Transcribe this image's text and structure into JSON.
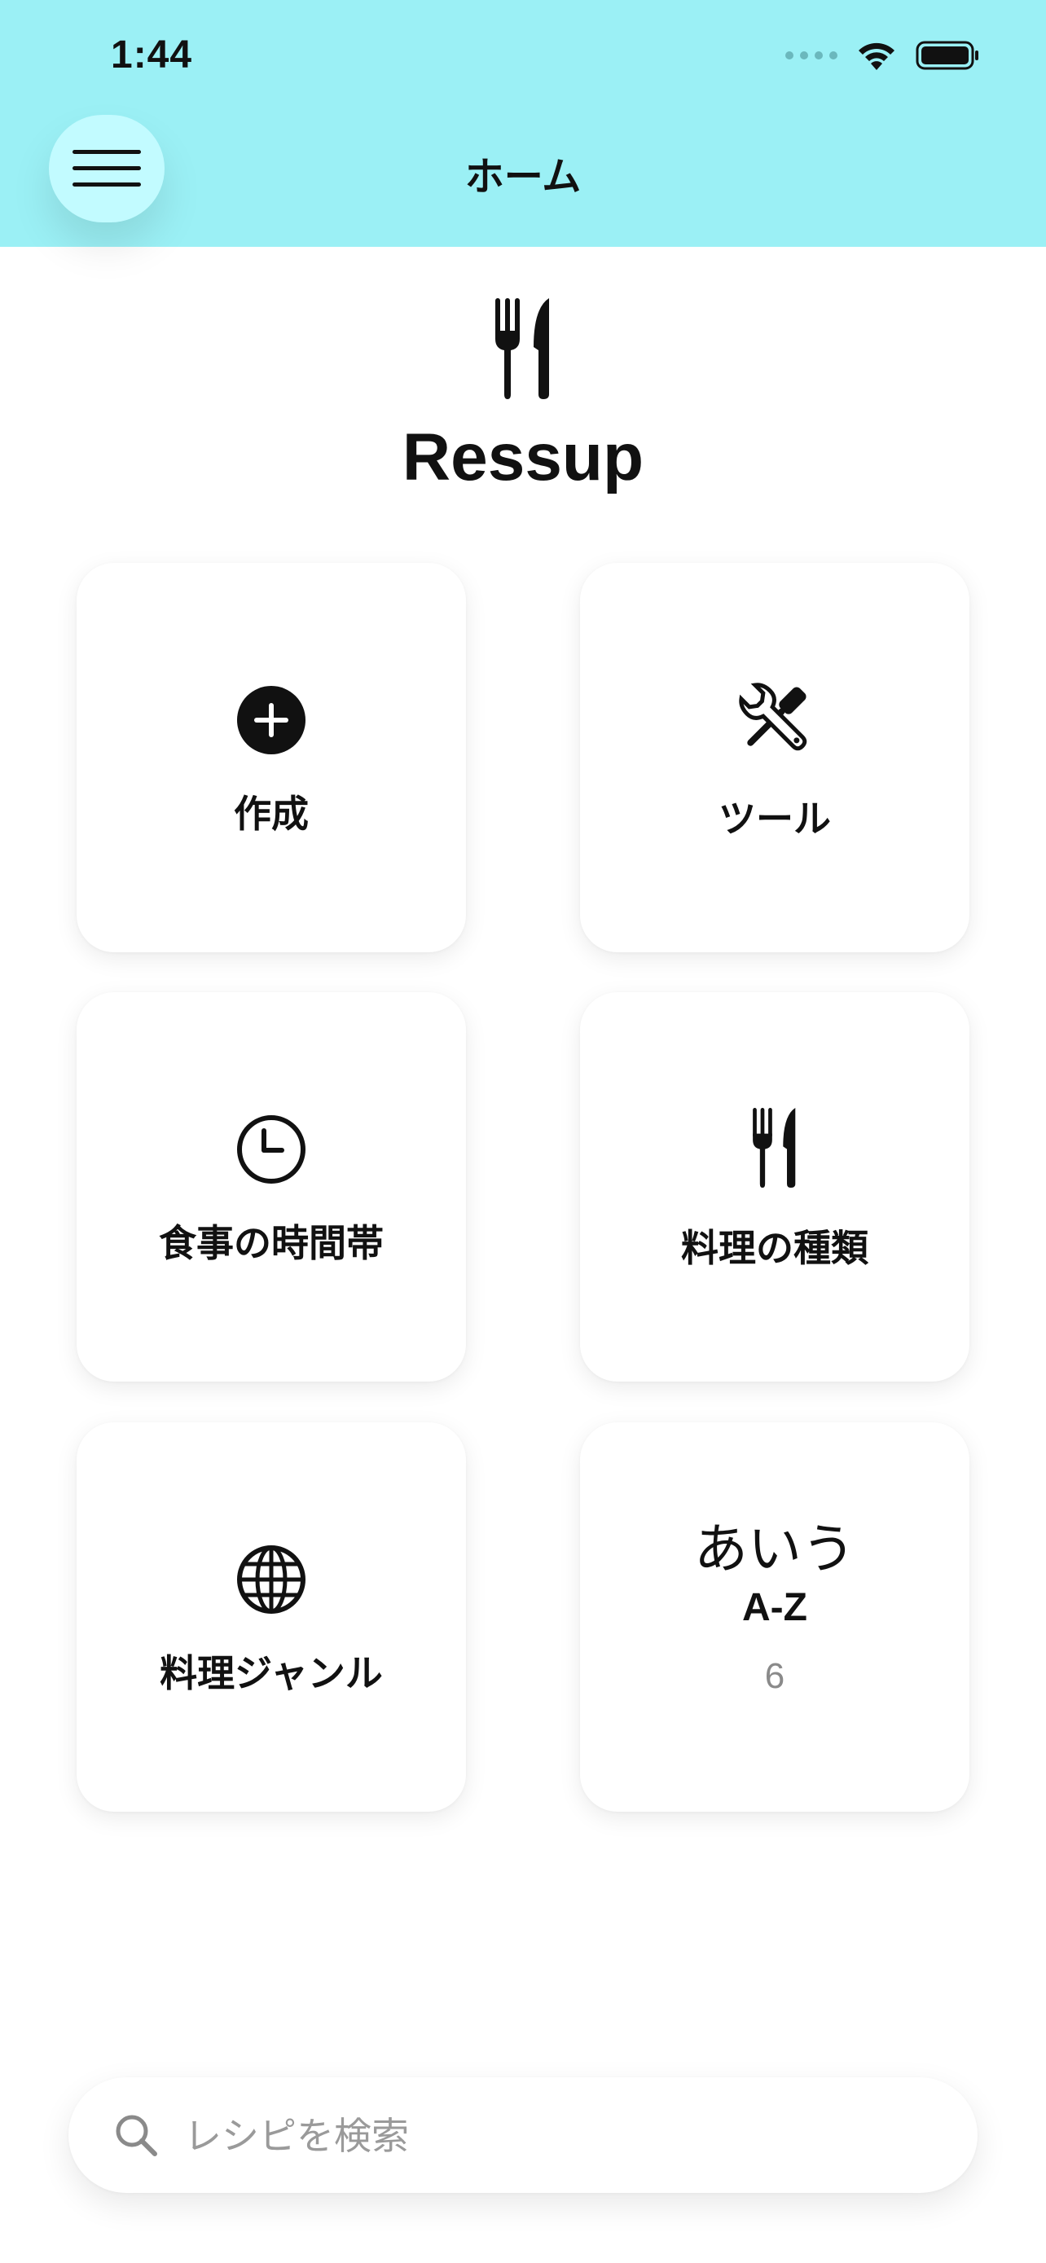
{
  "status_bar": {
    "time": "1:44"
  },
  "header": {
    "title": "ホーム"
  },
  "brand": {
    "name": "Ressup",
    "icon": "fork-knife-icon"
  },
  "tiles": [
    {
      "label": "作成",
      "icon": "plus-circle-icon"
    },
    {
      "label": "ツール",
      "icon": "tools-icon"
    },
    {
      "label": "食事の時間帯",
      "icon": "clock-icon"
    },
    {
      "label": "料理の種類",
      "icon": "fork-knife-icon"
    },
    {
      "label": "料理ジャンル",
      "icon": "globe-icon"
    },
    {
      "kana": "あいう",
      "label": "A-Z",
      "count": "6"
    }
  ],
  "search": {
    "placeholder": "レシピを検索",
    "value": ""
  },
  "colors": {
    "header_bg": "#9bf0f5",
    "menu_button_bg": "#c2fbff",
    "placeholder": "#9a9a9a"
  }
}
